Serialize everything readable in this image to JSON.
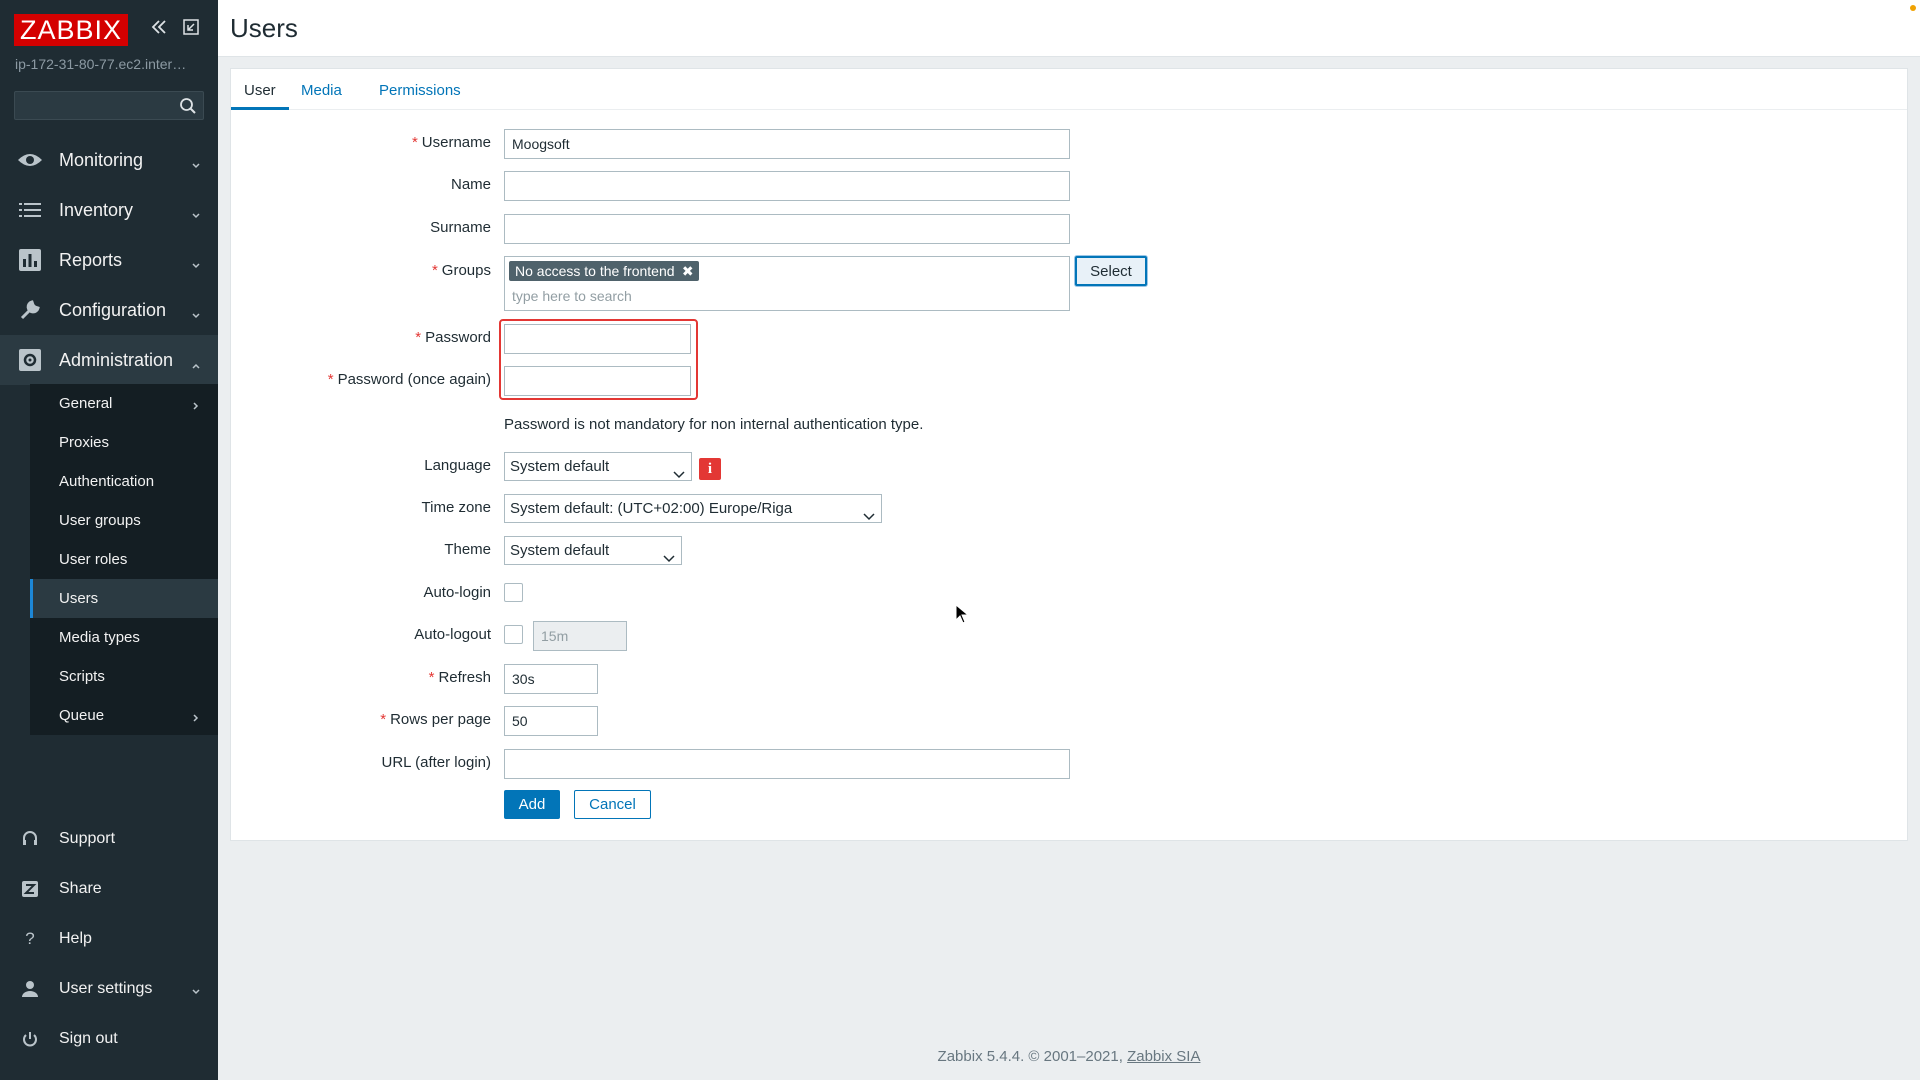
{
  "app": {
    "logo": "ZABBIX",
    "server": "ip-172-31-80-77.ec2.inter…",
    "search_placeholder": ""
  },
  "nav": {
    "monitoring": "Monitoring",
    "inventory": "Inventory",
    "reports": "Reports",
    "configuration": "Configuration",
    "administration": "Administration"
  },
  "submenu": {
    "general": "General",
    "proxies": "Proxies",
    "authentication": "Authentication",
    "user_groups": "User groups",
    "user_roles": "User roles",
    "users": "Users",
    "media_types": "Media types",
    "scripts": "Scripts",
    "queue": "Queue"
  },
  "footer_nav": {
    "support": "Support",
    "share": "Share",
    "help": "Help",
    "user_settings": "User settings",
    "sign_out": "Sign out"
  },
  "page": {
    "title": "Users",
    "tabs": [
      "User",
      "Media",
      "Permissions"
    ]
  },
  "form": {
    "required_mark": "*",
    "labels": {
      "username": "Username",
      "name": "Name",
      "surname": "Surname",
      "groups": "Groups",
      "password": "Password",
      "password_again": "Password (once again)",
      "language": "Language",
      "time_zone": "Time zone",
      "theme": "Theme",
      "auto_login": "Auto-login",
      "auto_logout": "Auto-logout",
      "refresh": "Refresh",
      "rows_per_page": "Rows per page",
      "url_after_login": "URL (after login)"
    },
    "values": {
      "username": "Moogsoft",
      "name": "",
      "surname": "",
      "group_tag": "No access to the frontend",
      "group_tag_remove": "✖",
      "groups_search_placeholder": "type here to search",
      "password": "",
      "password_again": "",
      "password_hint": "Password is not mandatory for non internal authentication type.",
      "language": "System default",
      "language_info": "i",
      "time_zone": "System default: (UTC+02:00) Europe/Riga",
      "theme": "System default",
      "auto_login_checked": false,
      "auto_logout_checked": false,
      "auto_logout_value": "15m",
      "refresh": "30s",
      "rows_per_page": "50",
      "url_after_login": ""
    },
    "buttons": {
      "select": "Select",
      "add": "Add",
      "cancel": "Cancel"
    }
  },
  "footer": {
    "text": "Zabbix 5.4.4. © 2001–2021,",
    "link": "Zabbix SIA"
  },
  "colors": {
    "sidebar_bg": "#1f2c33",
    "accent": "#0275b8",
    "required": "#e33734",
    "logo_red": "#d40000"
  }
}
